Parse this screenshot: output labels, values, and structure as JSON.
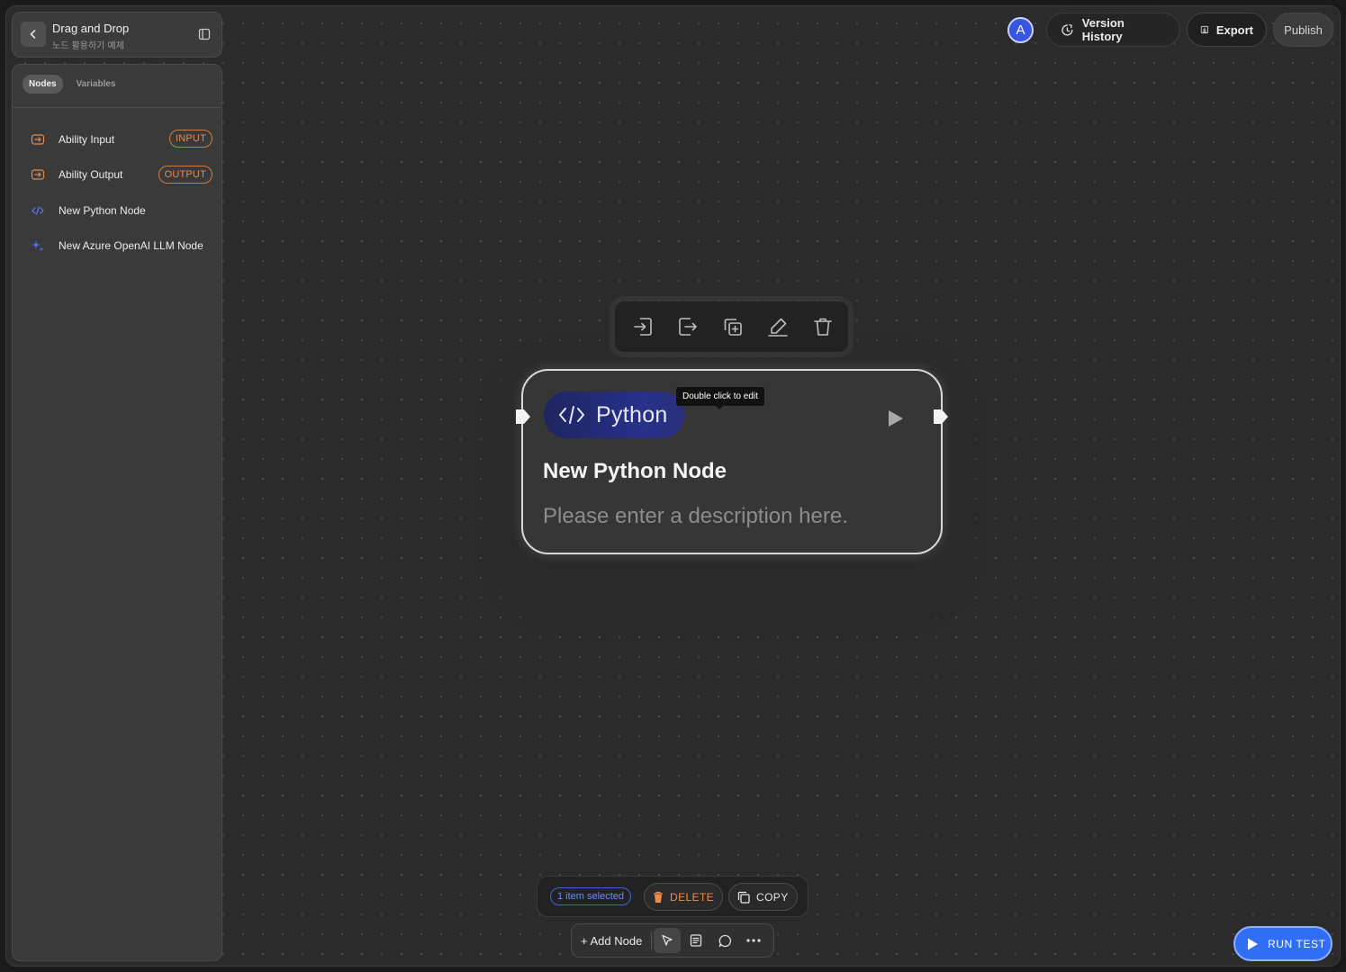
{
  "header": {
    "title": "Drag and Drop",
    "subtitle": "노드 활용하기 예제"
  },
  "sidebar": {
    "tabs": [
      {
        "label": "Nodes",
        "active": true
      },
      {
        "label": "Variables",
        "active": false
      }
    ],
    "items": [
      {
        "label": "Ability Input",
        "badge": "INPUT",
        "icon": "ability-io-icon"
      },
      {
        "label": "Ability Output",
        "badge": "OUTPUT",
        "icon": "ability-io-icon"
      },
      {
        "label": "New Python Node",
        "badge": "",
        "icon": "code-icon"
      },
      {
        "label": "New Azure OpenAI LLM Node",
        "badge": "",
        "icon": "sparkle-icon"
      }
    ]
  },
  "topbar": {
    "avatar_initial": "A",
    "version_history": "Version History",
    "export": "Export",
    "publish": "Publish"
  },
  "node": {
    "type_label": "Python",
    "tooltip": "Double click to edit",
    "title": "New Python Node",
    "description": "Please enter a description here.",
    "toolbar_icons": [
      "input-icon",
      "output-icon",
      "duplicate-icon",
      "edit-icon",
      "trash-icon"
    ]
  },
  "selection": {
    "count_label": "1 item selected",
    "delete_label": "DELETE",
    "copy_label": "COPY"
  },
  "tools": {
    "add_node": "+ Add Node"
  },
  "run_test": "RUN TEST",
  "colors": {
    "accent_blue": "#2f6ef5",
    "accent_orange": "#e08a4c",
    "python_chip": "#27318a"
  }
}
